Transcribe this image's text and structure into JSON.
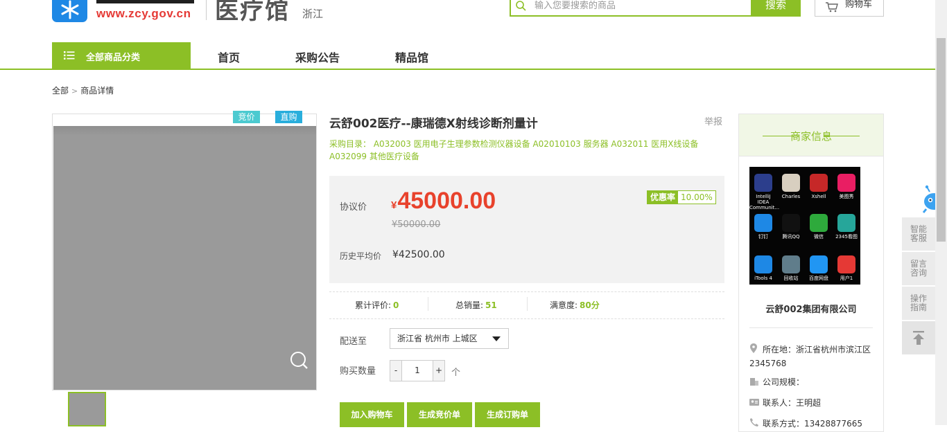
{
  "header": {
    "logo_url": "www.zcy.gov.cn",
    "store_title": "医疗馆",
    "region": "浙江",
    "search": {
      "placeholder": "输入您要搜索的商品",
      "button": "搜索"
    },
    "cart_label": "购物车"
  },
  "nav": {
    "category_label": "全部商品分类",
    "items": [
      "首页",
      "采购公告",
      "精品馆"
    ]
  },
  "breadcrumb": {
    "root": "全部",
    "current": "商品详情"
  },
  "gallery": {
    "tags": [
      "竞价",
      "直购"
    ]
  },
  "product": {
    "title": "云舒002医疗--康瑞德X射线诊断剂量计",
    "report_label": "举报",
    "catalog": "采购目录： A032003 医用电子生理参数检测仪器设备 A02010103 服务器 A032011 医用X线设备 A032099 其他医疗设备",
    "price_label": "协议价",
    "currency": "¥",
    "price": "45000.00",
    "old_price": "¥50000.00",
    "discount_label": "优惠率",
    "discount_value": "10.00%",
    "history_label": "历史平均价",
    "history_value": "¥42500.00"
  },
  "stats": {
    "reviews_label": "累计评价:",
    "reviews_value": "0",
    "sales_label": "总销量:",
    "sales_value": "51",
    "satisfaction_label": "满意度:",
    "satisfaction_value": "80分"
  },
  "purchase": {
    "ship_label": "配送至",
    "ship_value": "浙江省 杭州市 上城区",
    "qty_label": "购买数量",
    "qty_minus": "-",
    "qty_value": "1",
    "qty_plus": "+",
    "qty_unit": "个",
    "buttons": [
      "加入购物车",
      "生成竞价单",
      "生成订购单"
    ]
  },
  "merchant": {
    "title": "商家信息",
    "logo_icons": [
      {
        "label": "IntelliJ IDEA Communit...",
        "color": "#2c3e8c"
      },
      {
        "label": "Charles",
        "color": "#d8cfc0"
      },
      {
        "label": "Xshell",
        "color": "#c62828"
      },
      {
        "label": "美图秀",
        "color": "#e91e63"
      },
      {
        "label": "钉钉",
        "color": "#1e88e5"
      },
      {
        "label": "腾讯QQ",
        "color": "#111111"
      },
      {
        "label": "微信",
        "color": "#2eaa3c"
      },
      {
        "label": "2345看图",
        "color": "#26a69a"
      },
      {
        "label": "iTools 4",
        "color": "#1e88e5"
      },
      {
        "label": "回收站",
        "color": "#607d8b"
      },
      {
        "label": "百度网盘",
        "color": "#2196f3"
      },
      {
        "label": "用户1",
        "color": "#e53935"
      }
    ],
    "name": "云舒002集团有限公司",
    "location": "所在地：浙江省杭州市滨江区2345768",
    "scale": "公司规模：",
    "contact": "联系人：王明超",
    "phone": "联系方式：13428877665"
  },
  "float_bar": [
    "智能客服",
    "留言咨询",
    "操作指南"
  ],
  "colors": {
    "accent": "#8cbf26",
    "price": "#e8422c",
    "logo": "#1e88e5"
  }
}
